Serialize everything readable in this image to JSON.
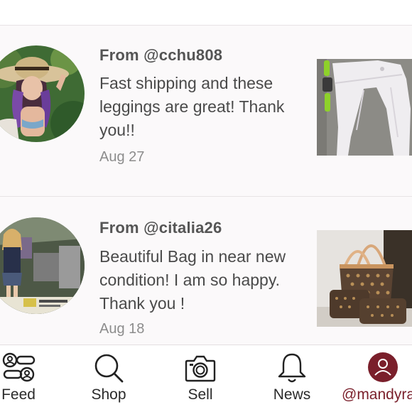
{
  "reviews": [
    {
      "from": "From @cchu808",
      "message": "Fast shipping and these leggings are great! Thank you!!",
      "date": "Aug 27",
      "avatar_icon": "user-photo-sunhat",
      "thumbnail_icon": "white-leggings-photo"
    },
    {
      "from": "From @citalia26",
      "message": "Beautiful Bag in near new condition! I am so happy. Thank you !",
      "date": "Aug 18",
      "avatar_icon": "user-photo-girl",
      "thumbnail_icon": "monogram-bag-photo"
    }
  ],
  "tabbar": {
    "feed": {
      "label": "Feed",
      "icon": "feed-icon"
    },
    "shop": {
      "label": "Shop",
      "icon": "search-icon"
    },
    "sell": {
      "label": "Sell",
      "icon": "camera-icon"
    },
    "news": {
      "label": "News",
      "icon": "bell-icon"
    },
    "me": {
      "label": "@mandyrae",
      "icon": "profile-icon"
    }
  },
  "colors": {
    "accent": "#7a1f2b",
    "background": "#fbf9fa",
    "text": "#4a4a4a",
    "muted": "#8c8c8c"
  }
}
